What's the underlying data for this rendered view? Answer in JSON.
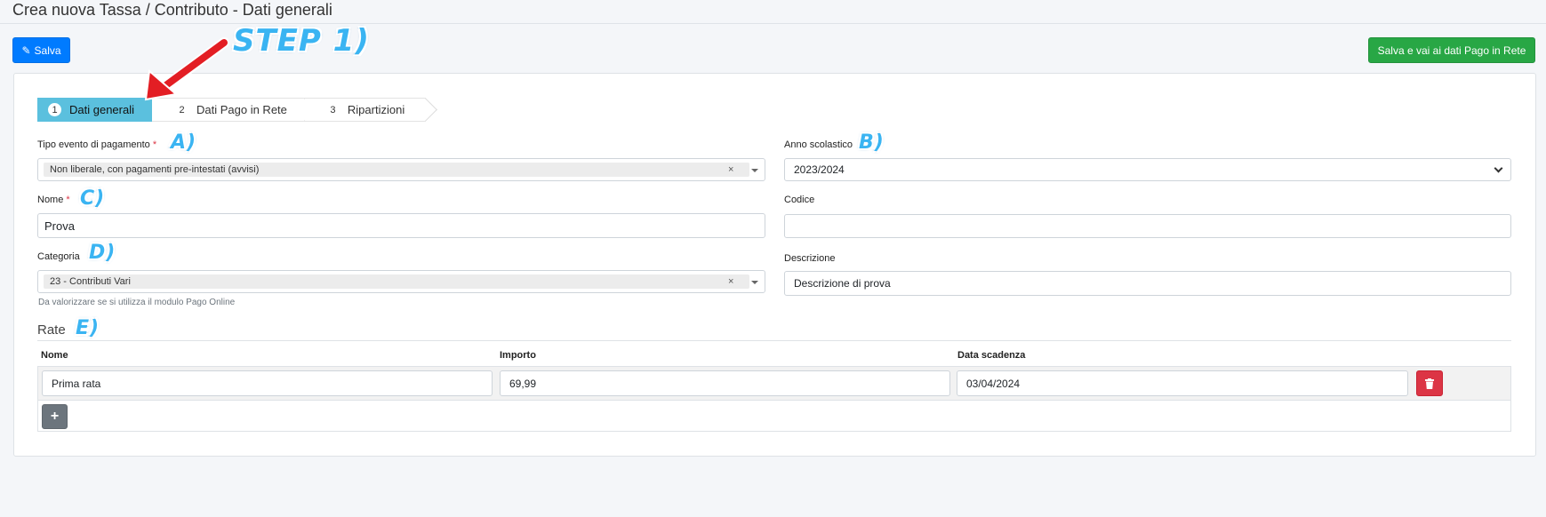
{
  "header": {
    "title": "Crea nuova Tassa / Contributo - Dati generali"
  },
  "toolbar": {
    "save_label": "Salva",
    "save_next_label": "Salva e vai ai dati Pago in Rete"
  },
  "wizard": {
    "steps": [
      {
        "num": "1",
        "label": "Dati generali"
      },
      {
        "num": "2",
        "label": "Dati Pago in Rete"
      },
      {
        "num": "3",
        "label": "Ripartizioni"
      }
    ]
  },
  "form": {
    "tipo_evento": {
      "label": "Tipo evento di pagamento",
      "required_mark": "*",
      "value": "Non liberale, con pagamenti pre-intestati (avvisi)"
    },
    "anno": {
      "label": "Anno scolastico",
      "value": "2023/2024"
    },
    "nome": {
      "label": "Nome",
      "required_mark": "*",
      "value": "Prova"
    },
    "codice": {
      "label": "Codice",
      "value": ""
    },
    "categoria": {
      "label": "Categoria",
      "value": "23 - Contributi Vari",
      "help": "Da valorizzare se si utilizza il modulo Pago Online"
    },
    "descrizione": {
      "label": "Descrizione",
      "value": "Descrizione di prova"
    }
  },
  "rate": {
    "title": "Rate",
    "columns": [
      "Nome",
      "Importo",
      "Data scadenza"
    ],
    "rows": [
      {
        "nome": "Prima rata",
        "importo": "69,99",
        "data_scadenza": "03/04/2024"
      }
    ]
  },
  "annotations": {
    "step": "STEP 1)",
    "a": "A)",
    "b": "B)",
    "c": "C)",
    "d": "D)",
    "e": "E)",
    "arrow_color": "#e31e24"
  },
  "colors": {
    "primary": "#007bff",
    "success": "#28a745",
    "danger": "#dc3545",
    "active_step": "#5bc0de"
  }
}
